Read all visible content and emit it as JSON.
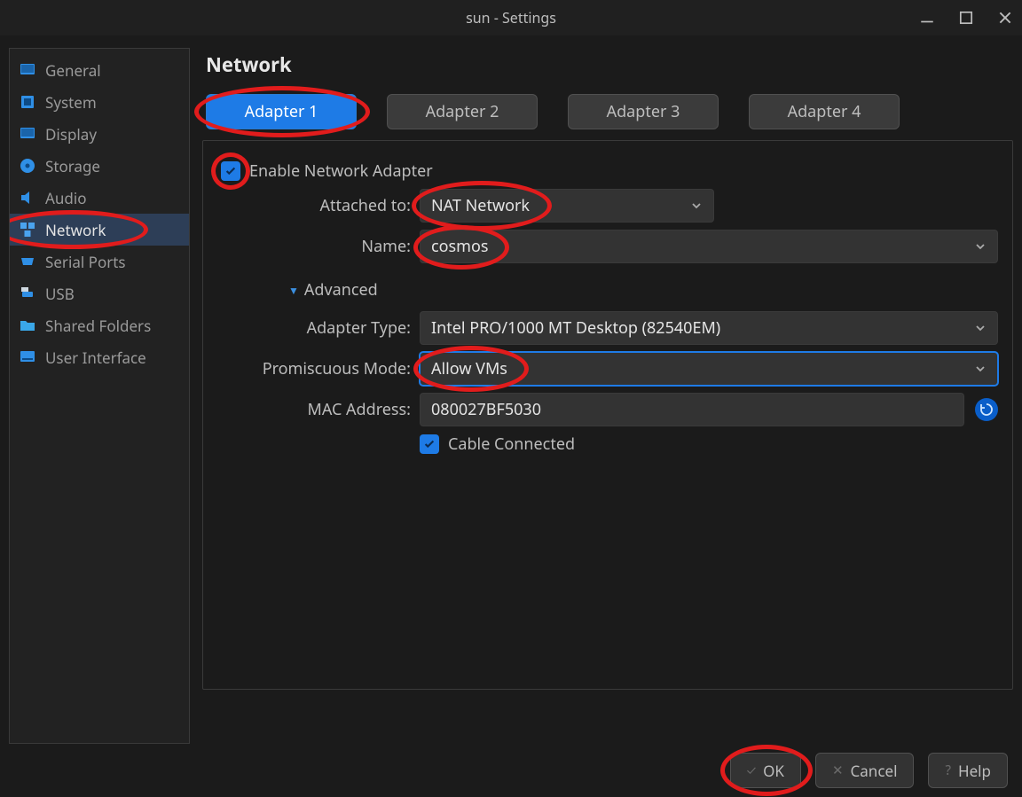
{
  "window": {
    "title": "sun - Settings"
  },
  "sidebar": {
    "items": [
      {
        "label": "General",
        "icon": "monitor"
      },
      {
        "label": "System",
        "icon": "chip"
      },
      {
        "label": "Display",
        "icon": "monitor"
      },
      {
        "label": "Storage",
        "icon": "disk"
      },
      {
        "label": "Audio",
        "icon": "speaker"
      },
      {
        "label": "Network",
        "icon": "network"
      },
      {
        "label": "Serial Ports",
        "icon": "serial"
      },
      {
        "label": "USB",
        "icon": "usb"
      },
      {
        "label": "Shared Folders",
        "icon": "folder"
      },
      {
        "label": "User Interface",
        "icon": "ui"
      }
    ],
    "selected_index": 5
  },
  "main": {
    "heading": "Network",
    "tabs": [
      "Adapter 1",
      "Adapter 2",
      "Adapter 3",
      "Adapter 4"
    ],
    "active_tab": 0,
    "enable_adapter": {
      "label": "Enable Network Adapter",
      "checked": true
    },
    "attached_to": {
      "label": "Attached to:",
      "value": "NAT Network"
    },
    "name": {
      "label": "Name:",
      "value": "cosmos"
    },
    "advanced_label": "Advanced",
    "adapter_type": {
      "label": "Adapter Type:",
      "value": "Intel PRO/1000 MT Desktop (82540EM)"
    },
    "promiscuous_mode": {
      "label": "Promiscuous Mode:",
      "value": "Allow VMs"
    },
    "mac_address": {
      "label": "MAC Address:",
      "value": "080027BF5030"
    },
    "cable_connected": {
      "label": "Cable Connected",
      "checked": true
    }
  },
  "footer": {
    "ok": "OK",
    "cancel": "Cancel",
    "help": "Help"
  }
}
